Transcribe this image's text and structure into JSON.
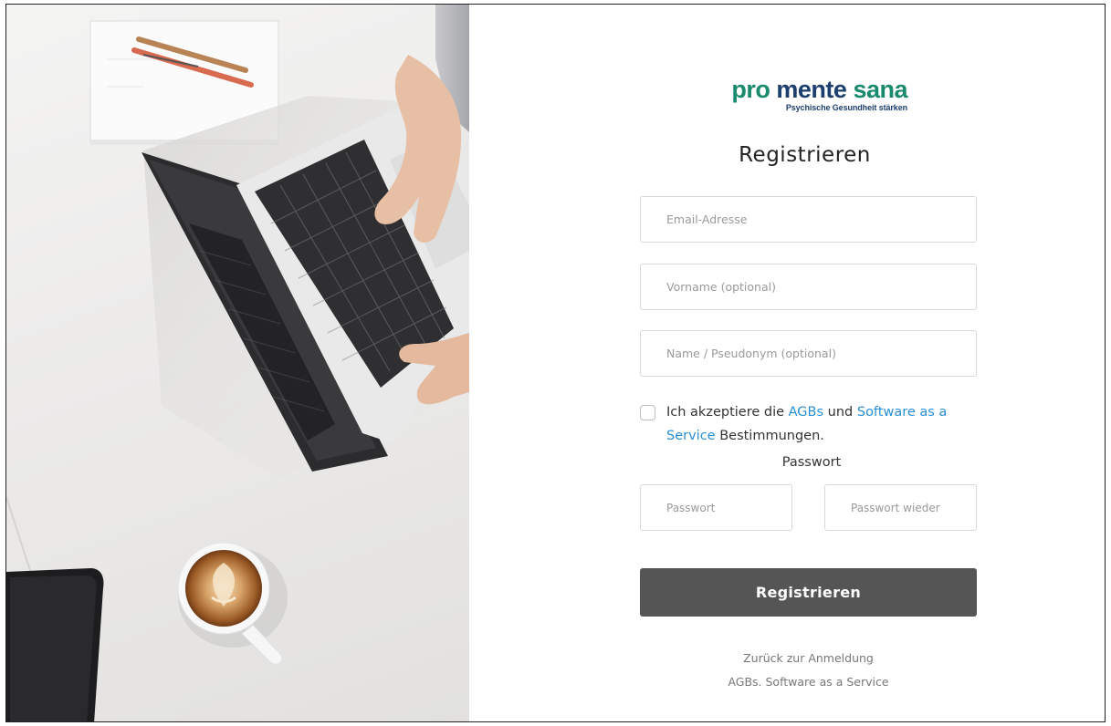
{
  "logo": {
    "part1": "pro",
    "part2": "mente",
    "part3": "sana",
    "tagline": "Psychische Gesundheit stärken",
    "colors": {
      "green": "#1a8a6e",
      "navy": "#1c3f6e"
    }
  },
  "form": {
    "title": "Registrieren",
    "email_placeholder": "Email-Adresse",
    "firstname_placeholder": "Vorname (optional)",
    "name_placeholder": "Name / Pseudonym (optional)",
    "consent": {
      "prefix": "Ich akzeptiere die",
      "agb_link": "AGBs",
      "middle": "und",
      "saas_link": "Software as a Service",
      "suffix": "Bestimmungen.",
      "checked": false
    },
    "password_label": "Passwort",
    "password_placeholder": "Passwort",
    "password_repeat_placeholder": "Passwort wieder",
    "submit_label": "Registrieren"
  },
  "footer": {
    "back_link": "Zurück zur Anmeldung",
    "terms_link": "AGBs. Software as a Service"
  },
  "colors": {
    "link": "#2a8fd6",
    "button": "#555556"
  },
  "photo": {
    "subject": "laptop-desk-photo"
  }
}
